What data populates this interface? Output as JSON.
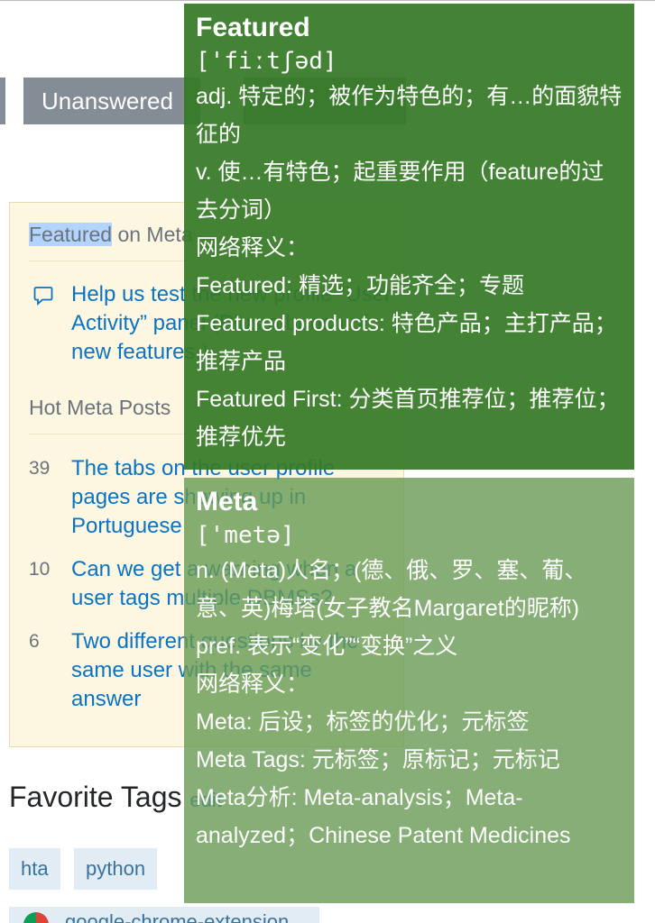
{
  "tabs": {
    "unanswered": "Unanswered"
  },
  "meta_box": {
    "heading_highlight": "Featured",
    "heading_rest": " on Meta",
    "featured_link": "Help us test the new profile “User Activity” panel (Plus a bunch of new features.)",
    "hot_heading": "Hot Meta Posts",
    "hot_posts": [
      {
        "count": "39",
        "title": "The tabs on the user profile pages are showing up in Portuguese"
      },
      {
        "count": "10",
        "title": "Can we get a warning when a user tags multiple DBMSs?"
      },
      {
        "count": "6",
        "title": "Two different questions by the same user with the same answer"
      }
    ]
  },
  "favorites": {
    "title": "Favorite Tags",
    "edit": "edit",
    "tags": [
      "hta",
      "python"
    ],
    "bottom_text": "google-chrome-extension"
  },
  "dict_featured": {
    "word": "Featured",
    "phonetic": "['fiːtʃəd]",
    "lines": [
      "adj. 特定的；被作为特色的；有…的面貌特征的",
      "v. 使…有特色；起重要作用（feature的过去分词）",
      "网络释义：",
      "Featured: 精选；功能齐全；专题",
      "Featured products: 特色产品；主打产品；推荐产品",
      "Featured First: 分类首页推荐位；推荐位；推荐优先"
    ]
  },
  "dict_meta": {
    "word": "Meta",
    "phonetic": "['metə]",
    "lines": [
      "n. (Meta)人名；(德、俄、罗、塞、葡、意、英)梅塔(女子教名Margaret的昵称)",
      "pref. 表示“变化”“变换”之义",
      "网络释义：",
      "Meta: 后设；标签的优化；元标签",
      "Meta Tags: 元标签；原标记；元标记",
      "Meta分析: Meta-analysis；Meta-analyzed；Chinese Patent Medicines"
    ]
  }
}
